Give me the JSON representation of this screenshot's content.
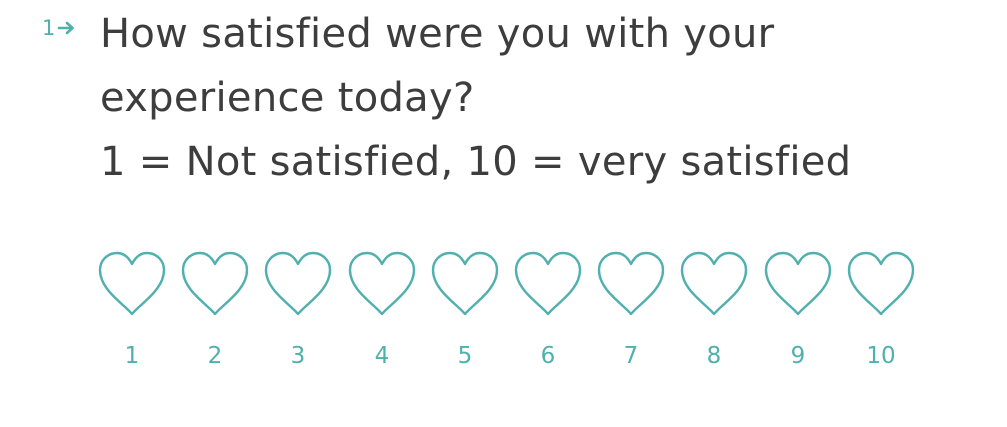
{
  "question": {
    "number": "1",
    "number_icon": "arrow-right-icon",
    "title_lines": [
      "How satisfied were you with your",
      "experience today?",
      "1 = Not satisfied, 10 = very satisfied"
    ]
  },
  "rating": {
    "shape_icon": "heart-outline-icon",
    "accent_color": "#4fb0ad",
    "options": [
      "1",
      "2",
      "3",
      "4",
      "5",
      "6",
      "7",
      "8",
      "9",
      "10"
    ]
  }
}
